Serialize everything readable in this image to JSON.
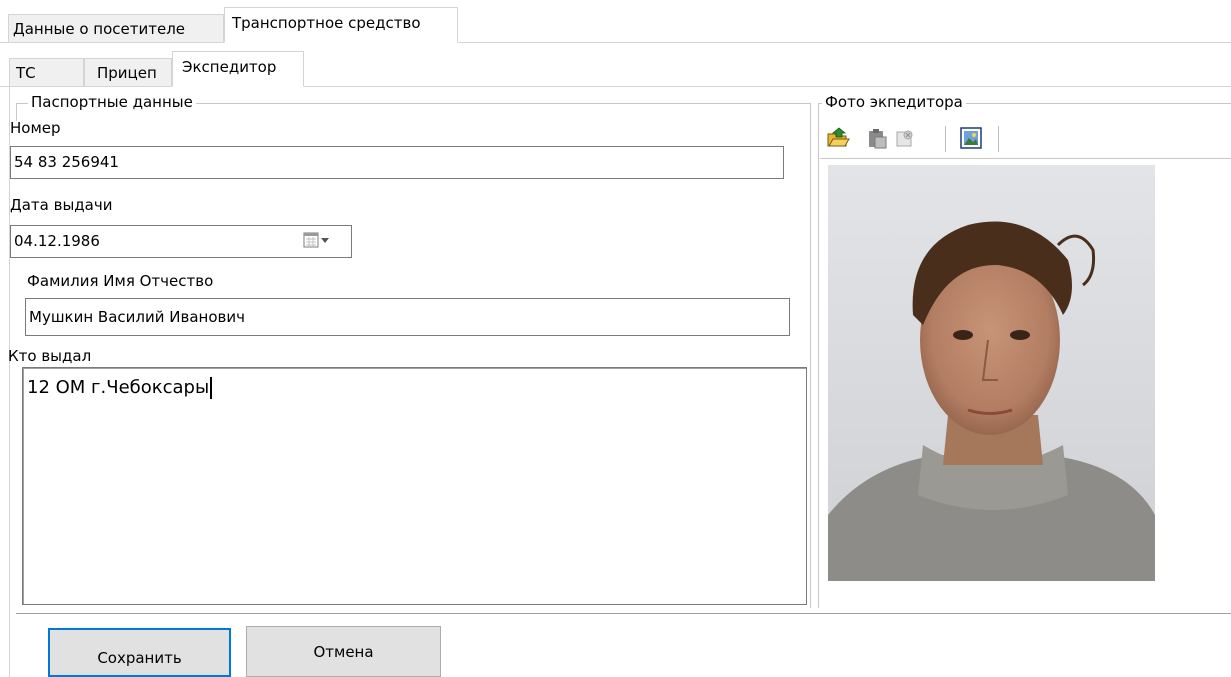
{
  "top_tabs": [
    {
      "label": "Данные о посетителе"
    },
    {
      "label": "Транспортное средство"
    }
  ],
  "sub_tabs": [
    {
      "label": "ТС"
    },
    {
      "label": "Прицеп"
    },
    {
      "label": "Экспедитор"
    }
  ],
  "passport": {
    "group_title": "Паспортные данные",
    "number_label": "Номер",
    "number_value": "54 83 256941",
    "date_label": "Дата выдачи",
    "date_value": "04.12.1986",
    "fio_label": "Фамилия Имя Отчество",
    "fio_value": "Мушкин Василий Иванович",
    "issuer_label": "Кто выдал",
    "issuer_value": "12 ОМ г.Чебоксары"
  },
  "photo": {
    "group_title": "Фото экпедитора",
    "toolbar_icons": [
      "open-photo-icon",
      "paste-icon",
      "delete-photo-icon",
      "webcam-capture-icon"
    ]
  },
  "buttons": {
    "save_label": "Сохранить",
    "cancel_label": "Отмена"
  }
}
